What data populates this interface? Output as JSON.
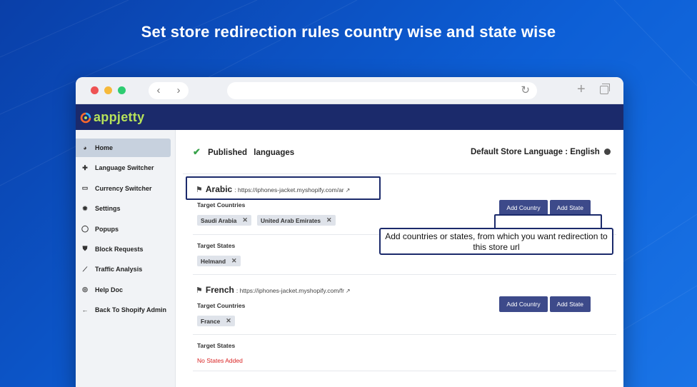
{
  "headline": "Set store redirection rules country wise and state wise",
  "app": {
    "logo_text": "appjetty"
  },
  "sidebar": {
    "items": [
      {
        "label": "Home",
        "icon": "dashboard-icon",
        "active": true
      },
      {
        "label": "Language Switcher",
        "icon": "puzzle-icon"
      },
      {
        "label": "Currency Switcher",
        "icon": "money-icon"
      },
      {
        "label": "Settings",
        "icon": "gear-icon"
      },
      {
        "label": "Popups",
        "icon": "chat-icon"
      },
      {
        "label": "Block Requests",
        "icon": "shield-icon"
      },
      {
        "label": "Traffic Analysis",
        "icon": "chart-line-icon"
      },
      {
        "label": "Help Doc",
        "icon": "lifebuoy-icon"
      },
      {
        "label": "Back To Shopify Admin",
        "icon": "arrow-left-icon"
      }
    ]
  },
  "main": {
    "published_label": "Published",
    "languages_label": "languages",
    "default_store_label": "Default Store Language : English",
    "languages": [
      {
        "name": "Arabic",
        "url": "https://iphones-jacket.myshopify.com/ar",
        "target_countries_label": "Target Countries",
        "countries": [
          "Saudi Arabia",
          "United Arab Emirates"
        ],
        "target_states_label": "Target States",
        "states": [
          "Helmand"
        ]
      },
      {
        "name": "French",
        "url": "https://iphones-jacket.myshopify.com/fr",
        "target_countries_label": "Target Countries",
        "countries": [
          "France"
        ],
        "target_states_label": "Target States",
        "no_states": "No States Added"
      }
    ],
    "add_country_label": "Add Country",
    "add_state_label": "Add State",
    "callout_text": "Add countries or states, from which you want redirection to this store url"
  },
  "colors": {
    "background": "#0d5fd6",
    "appbar": "#1b2a6b",
    "button": "#3d4a8a",
    "logo": "#b7e25a",
    "error": "#d92323"
  }
}
